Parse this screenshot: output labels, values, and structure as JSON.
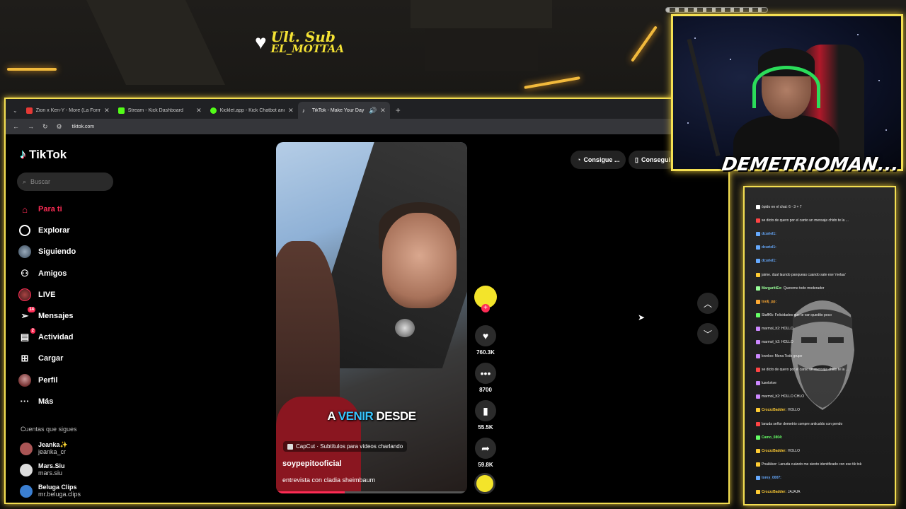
{
  "overlay": {
    "sub_title": "Ult. Sub",
    "sub_name": "EL_MOTTAA",
    "streamer_name": "DEMETRIOMAN..."
  },
  "browser": {
    "tabs": [
      {
        "title": "Zion x Ken-Y - More (La Formula...",
        "favicon_color": "#e53935"
      },
      {
        "title": "Stream - Kick Dashboard",
        "favicon_color": "#53fc18"
      },
      {
        "title": "Kicklet.app - Kick Chatbot and ...",
        "favicon_color": "#53fc18"
      },
      {
        "title": "TikTok - Make Your Day",
        "favicon_color": "#ffffff"
      }
    ],
    "url": "tiktok.com"
  },
  "tiktok": {
    "logo_text": "TikTok",
    "search_placeholder": "Buscar",
    "nav": [
      {
        "label": "Para ti",
        "icon": "home-icon",
        "active": true
      },
      {
        "label": "Explorar",
        "icon": "compass-icon"
      },
      {
        "label": "Siguiendo",
        "icon": "following-avatar-icon"
      },
      {
        "label": "Amigos",
        "icon": "friends-icon"
      },
      {
        "label": "LIVE",
        "icon": "live-icon"
      },
      {
        "label": "Mensajes",
        "icon": "messages-icon",
        "badge": "14"
      },
      {
        "label": "Actividad",
        "icon": "activity-icon",
        "badge": "2"
      },
      {
        "label": "Cargar",
        "icon": "upload-icon"
      },
      {
        "label": "Perfil",
        "icon": "profile-icon"
      },
      {
        "label": "Más",
        "icon": "more-icon"
      }
    ],
    "following_title": "Cuentas que sigues",
    "following": [
      {
        "name": "Jeanka✨",
        "handle": "jeanka_cr"
      },
      {
        "name": "Mars.Siu",
        "handle": "mars.siu"
      },
      {
        "name": "Beluga Clips",
        "handle": "mr.beluga.clips"
      }
    ],
    "get_app_1": "Consigue ...",
    "get_app_2": "Consegui",
    "video": {
      "caption_pre": "A",
      "caption_highlight": "VENIR",
      "caption_post": "DESDE",
      "capcut_label": "CapCut · Subtítulos para vídeos charlando",
      "author": "soypepitooficial",
      "description": "entrevista con cladia sheimbaum",
      "progress": 0.36
    },
    "actions": {
      "likes": "760.3K",
      "comments": "8700",
      "saves": "55.5K",
      "shares": "59.8K"
    }
  },
  "chat": {
    "lines": [
      {
        "user": "",
        "text": "ópido en el chat: 6 - 3 + 7",
        "color": "#ffffff"
      },
      {
        "user": "",
        "text": "se dicto de quero por el canto un mensaje chido te la ...",
        "color": "#ff4444"
      },
      {
        "user": "dcuriel1:",
        "text": "",
        "color": "#66aaff"
      },
      {
        "user": "dcuriel1:",
        "text": "",
        "color": "#66aaff"
      },
      {
        "user": "dcuriel1:",
        "text": "",
        "color": "#66aaff"
      },
      {
        "user": "",
        "text": "jaime. dual laundo panqueas cuando sale ese 'melaa'",
        "color": "#ffcc33"
      },
      {
        "user": "MargaritiEx:",
        "text": "Quereme todo moderador",
        "color": "#99ff99"
      },
      {
        "user": "toolj_pp:",
        "text": "",
        "color": "#ffaa33"
      },
      {
        "user": "",
        "text": "StaffKk: Felicidades que te van quedito poco",
        "color": "#66ff66"
      },
      {
        "user": "",
        "text": "marmol_h2:  HOLLO",
        "color": "#cc88ff"
      },
      {
        "user": "",
        "text": "marmol_h2:  HOLLO",
        "color": "#cc88ff"
      },
      {
        "user": "",
        "text": "loveloo: Mona Todo grupe",
        "color": "#cc88ff"
      },
      {
        "user": "",
        "text": "se dicto de quero por el canto un mensaje chido te la ...",
        "color": "#ff4444"
      },
      {
        "user": "",
        "text": "luxelokve",
        "color": "#cc88ff"
      },
      {
        "user": "",
        "text": "marmol_h2:  HOLLO CHLO",
        "color": "#cc88ff"
      },
      {
        "user": "CrozzzBadder:",
        "text": "HOLLO",
        "color": "#ffcc33"
      },
      {
        "user": "",
        "text": "lanuda señor demetrio compre anticaído con pendo",
        "color": "#ff4444"
      },
      {
        "user": "Camo_0804:",
        "text": "",
        "color": "#66ff66"
      },
      {
        "user": "CrozzzBadder:",
        "text": "HOLLO",
        "color": "#ffcc33"
      },
      {
        "user": "",
        "text": "Pnakkker: Lanuda cuándo me siento identificado con ese tik tok",
        "color": "#ffcc33"
      },
      {
        "user": "torey_0007:",
        "text": "",
        "color": "#66aaff"
      },
      {
        "user": "CrozzzBadder:",
        "text": "JAJAJA",
        "color": "#ffcc33"
      }
    ]
  }
}
